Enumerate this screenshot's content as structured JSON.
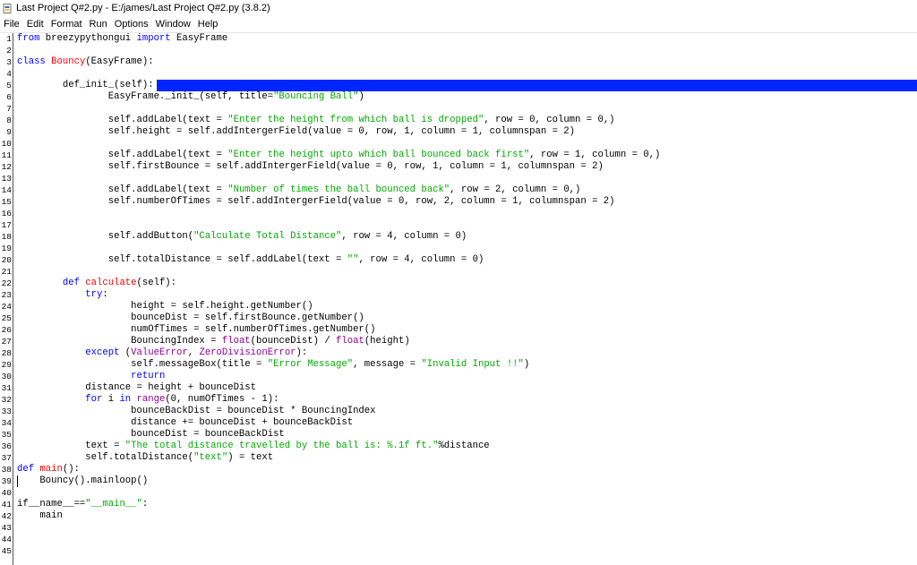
{
  "window": {
    "title": "Last Project Q#2.py - E:/james/Last Project Q#2.py (3.8.2)"
  },
  "menu": [
    "File",
    "Edit",
    "Format",
    "Run",
    "Options",
    "Window",
    "Help"
  ],
  "colors": {
    "keyword": "#0000ff",
    "string": "#00aa00",
    "definition": "#ff0000",
    "builtin": "#900090",
    "selection": "#0025ff"
  },
  "line_numbers": [
    "1",
    "2",
    "3",
    "4",
    "5",
    "6",
    "7",
    "8",
    "9",
    "10",
    "11",
    "12",
    "13",
    "14",
    "15",
    "16",
    "17",
    "18",
    "19",
    "20",
    "21",
    "22",
    "23",
    "24",
    "25",
    "26",
    "27",
    "28",
    "29",
    "30",
    "31",
    "32",
    "33",
    "34",
    "35",
    "36",
    "37",
    "38",
    "39",
    "40",
    "41",
    "42",
    "43",
    "44",
    "45"
  ],
  "code": [
    [
      {
        "t": "from",
        "c": "kw2"
      },
      {
        "t": " breezypythongui ",
        "c": ""
      },
      {
        "t": "import",
        "c": "kw2"
      },
      {
        "t": " EasyFrame",
        "c": ""
      }
    ],
    [],
    [
      {
        "t": "class",
        "c": "kw2"
      },
      {
        "t": " ",
        "c": ""
      },
      {
        "t": "Bouncy",
        "c": "def"
      },
      {
        "t": "(EasyFrame):",
        "c": ""
      }
    ],
    [],
    [
      {
        "t": "        def_init_(self):",
        "c": ""
      }
    ],
    [
      {
        "t": "                EasyFrame._init_(self, title=",
        "c": ""
      },
      {
        "t": "\"Bouncing Ball\"",
        "c": "str"
      },
      {
        "t": ")",
        "c": ""
      }
    ],
    [],
    [
      {
        "t": "                self.addLabel(text = ",
        "c": ""
      },
      {
        "t": "\"Enter the height from which ball is dropped\"",
        "c": "str"
      },
      {
        "t": ", row = 0, column = 0,)",
        "c": ""
      }
    ],
    [
      {
        "t": "                self.height = self.addIntergerField(value = 0, row, 1, column = 1, columnspan = 2)",
        "c": ""
      }
    ],
    [],
    [
      {
        "t": "                self.addLabel(text = ",
        "c": ""
      },
      {
        "t": "\"Enter the height upto which ball bounced back first\"",
        "c": "str"
      },
      {
        "t": ", row = 1, column = 0,)",
        "c": ""
      }
    ],
    [
      {
        "t": "                self.firstBounce = self.addIntergerField(value = 0, row, 1, column = 1, columnspan = 2)",
        "c": ""
      }
    ],
    [],
    [
      {
        "t": "                self.addLabel(text = ",
        "c": ""
      },
      {
        "t": "\"Number of times the ball bounced back\"",
        "c": "str"
      },
      {
        "t": ", row = 2, column = 0,)",
        "c": ""
      }
    ],
    [
      {
        "t": "                self.numberOfTimes = self.addIntergerField(value = 0, row, 2, column = 1, columnspan = 2)",
        "c": ""
      }
    ],
    [],
    [],
    [
      {
        "t": "                self.addButton(",
        "c": ""
      },
      {
        "t": "\"Calculate Total Distance\"",
        "c": "str"
      },
      {
        "t": ", row = 4, column = 0)",
        "c": ""
      }
    ],
    [],
    [
      {
        "t": "                self.totalDistance = self.addLabel(text = ",
        "c": ""
      },
      {
        "t": "\"\"",
        "c": "str"
      },
      {
        "t": ", row = 4, column = 0)",
        "c": ""
      }
    ],
    [],
    [
      {
        "t": "        ",
        "c": ""
      },
      {
        "t": "def",
        "c": "kw2"
      },
      {
        "t": " ",
        "c": ""
      },
      {
        "t": "calculate",
        "c": "def"
      },
      {
        "t": "(self):",
        "c": ""
      }
    ],
    [
      {
        "t": "            ",
        "c": ""
      },
      {
        "t": "try",
        "c": "kw2"
      },
      {
        "t": ":",
        "c": ""
      }
    ],
    [
      {
        "t": "                    height = self.height.getNumber()",
        "c": ""
      }
    ],
    [
      {
        "t": "                    bounceDist = self.firstBounce.getNumber()",
        "c": ""
      }
    ],
    [
      {
        "t": "                    numOfTimes = self.numberOfTimes.getNumber()",
        "c": ""
      }
    ],
    [
      {
        "t": "                    BouncingIndex = ",
        "c": ""
      },
      {
        "t": "float",
        "c": "bi"
      },
      {
        "t": "(bounceDist) / ",
        "c": ""
      },
      {
        "t": "float",
        "c": "bi"
      },
      {
        "t": "(height)",
        "c": ""
      }
    ],
    [
      {
        "t": "            ",
        "c": ""
      },
      {
        "t": "except",
        "c": "kw2"
      },
      {
        "t": " (",
        "c": ""
      },
      {
        "t": "ValueError",
        "c": "bi"
      },
      {
        "t": ", ",
        "c": ""
      },
      {
        "t": "ZeroDivisionError",
        "c": "bi"
      },
      {
        "t": "):",
        "c": ""
      }
    ],
    [
      {
        "t": "                    self.messageBox(title = ",
        "c": ""
      },
      {
        "t": "\"Error Message\"",
        "c": "str"
      },
      {
        "t": ", message = ",
        "c": ""
      },
      {
        "t": "\"Invalid Input !!\"",
        "c": "str"
      },
      {
        "t": ")",
        "c": ""
      }
    ],
    [
      {
        "t": "                    ",
        "c": ""
      },
      {
        "t": "return",
        "c": "kw2"
      }
    ],
    [
      {
        "t": "            distance = height + bounceDist",
        "c": ""
      }
    ],
    [
      {
        "t": "            ",
        "c": ""
      },
      {
        "t": "for",
        "c": "kw2"
      },
      {
        "t": " i ",
        "c": ""
      },
      {
        "t": "in",
        "c": "kw2"
      },
      {
        "t": " ",
        "c": ""
      },
      {
        "t": "range",
        "c": "bi"
      },
      {
        "t": "(0, numOfTimes - 1):",
        "c": ""
      }
    ],
    [
      {
        "t": "                    bounceBackDist = bounceDist * BouncingIndex",
        "c": ""
      }
    ],
    [
      {
        "t": "                    distance += bounceDist + bounceBackDist",
        "c": ""
      }
    ],
    [
      {
        "t": "                    bounceDist = bounceBackDist",
        "c": ""
      }
    ],
    [
      {
        "t": "            text = ",
        "c": ""
      },
      {
        "t": "\"The total distance travelled by the ball is: %.1f ft.\"",
        "c": "str"
      },
      {
        "t": "%distance",
        "c": ""
      }
    ],
    [
      {
        "t": "            self.totalDistance(",
        "c": ""
      },
      {
        "t": "\"text\"",
        "c": "str"
      },
      {
        "t": ") = text",
        "c": ""
      }
    ],
    [
      {
        "t": "def",
        "c": "kw2"
      },
      {
        "t": " ",
        "c": ""
      },
      {
        "t": "main",
        "c": "def"
      },
      {
        "t": "():",
        "c": ""
      }
    ],
    [
      {
        "t": "    Bouncy().mainloop()",
        "c": ""
      }
    ],
    [],
    [
      {
        "t": "if__name__==",
        "c": ""
      },
      {
        "t": "\"__main__\"",
        "c": "str"
      },
      {
        "t": ":",
        "c": ""
      }
    ],
    [
      {
        "t": "    main",
        "c": ""
      }
    ],
    [],
    [],
    []
  ]
}
